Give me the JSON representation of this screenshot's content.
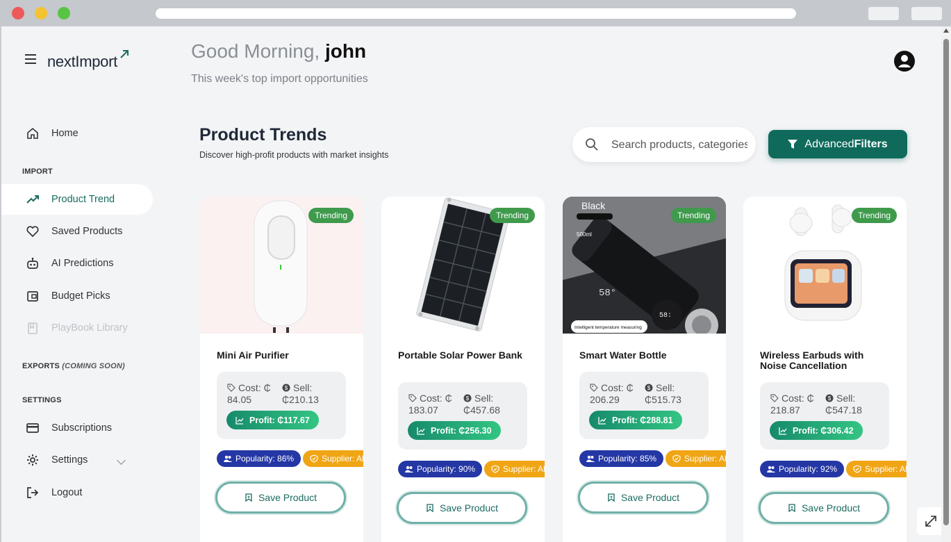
{
  "brand": {
    "name": "nextImport"
  },
  "header": {
    "greeting_prefix": "Good Morning,",
    "user_name": "john",
    "subtitle": "This week's top import opportunities"
  },
  "sidebar": {
    "home": "Home",
    "import_section": "IMPORT",
    "import_items": [
      {
        "label": "Product Trend",
        "icon": "trending-up-icon",
        "active": true
      },
      {
        "label": "Saved Products",
        "icon": "heart-icon"
      },
      {
        "label": "AI Predictions",
        "icon": "robot-icon"
      },
      {
        "label": "Budget Picks",
        "icon": "wallet-icon"
      },
      {
        "label": "PlayBook Library",
        "icon": "book-icon",
        "disabled": true
      }
    ],
    "exports_section": "EXPORTS",
    "exports_note": "(COMING SOON)",
    "settings_section": "SETTINGS",
    "subscriptions": "Subscriptions",
    "settings": "Settings",
    "logout": "Logout"
  },
  "main": {
    "title": "Product Trends",
    "subtitle": "Discover high-profit products with market insights",
    "search_placeholder": "Search products, categories...",
    "filters_prefix": "Advanced",
    "filters_bold": "Filters"
  },
  "products": [
    {
      "name": "Mini Air Purifier",
      "badge": "Trending",
      "cost_label": "Cost: ₵",
      "cost_value": "84.05",
      "sell_label": "Sell:",
      "sell_value": "₵210.13",
      "profit": "Profit: ₵117.67",
      "popularity": "Popularity: 86%",
      "supplier": "Supplier: Ali",
      "save": "Save Product"
    },
    {
      "name": "Portable Solar Power Bank",
      "badge": "Trending",
      "cost_label": "Cost: ₵",
      "cost_value": "183.07",
      "sell_label": "Sell:",
      "sell_value": "₵457.68",
      "profit": "Profit: ₵256.30",
      "popularity": "Popularity: 90%",
      "supplier": "Supplier: Ali",
      "save": "Save Product"
    },
    {
      "name": "Smart Water Bottle",
      "badge": "Trending",
      "cost_label": "Cost: ₵",
      "cost_value": "206.29",
      "sell_label": "Sell:",
      "sell_value": "₵515.73",
      "profit": "Profit: ₵288.81",
      "popularity": "Popularity: 85%",
      "supplier": "Supplier: Ali",
      "save": "Save Product",
      "image_caption": "Black",
      "image_caption2": "Intelligent temperature measuring",
      "image_caption3": "500ml"
    },
    {
      "name": "Wireless Earbuds with Noise Cancellation",
      "badge": "Trending",
      "cost_label": "Cost: ₵",
      "cost_value": "218.87",
      "sell_label": "Sell:",
      "sell_value": "₵547.18",
      "profit": "Profit: ₵306.42",
      "popularity": "Popularity: 92%",
      "supplier": "Supplier: Ali",
      "save": "Save Product"
    }
  ],
  "colors": {
    "accent": "#0f6a5c",
    "trending": "#3f9a4c",
    "popularity": "#2437a5",
    "supplier": "#f0a515"
  }
}
